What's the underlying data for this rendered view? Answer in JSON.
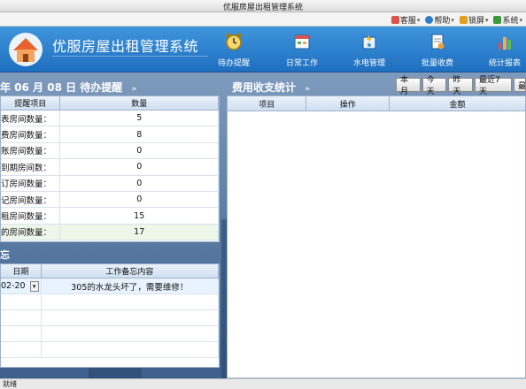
{
  "window": {
    "title": "优服房屋出租管理系统"
  },
  "top_menu": {
    "items": [
      {
        "label": "客服",
        "color": "#d9534f"
      },
      {
        "label": "帮助",
        "color": "#2f7cc7"
      },
      {
        "label": "锁屏",
        "color": "#e0a020"
      },
      {
        "label": "系统",
        "color": "#3a9a3a"
      }
    ]
  },
  "header": {
    "app_title": "优服房屋出租管理系统",
    "nav": [
      {
        "label": "待办提醒"
      },
      {
        "label": "日常工作"
      },
      {
        "label": "水电管理"
      },
      {
        "label": "批量收费"
      },
      {
        "label": "统计报表"
      }
    ]
  },
  "reminders": {
    "title": "年 06 月 08 日 待办提醒",
    "columns": [
      "提醒项目",
      "数量"
    ],
    "rows": [
      {
        "label": "表房间数量：",
        "value": "5"
      },
      {
        "label": "费房间数量：",
        "value": "8"
      },
      {
        "label": "账房间数量：",
        "value": "0"
      },
      {
        "label": "到期房间数：",
        "value": "0"
      },
      {
        "label": "订房间数量：",
        "value": "0"
      },
      {
        "label": "记房间数量：",
        "value": "0"
      },
      {
        "label": "租房间数量：",
        "value": "15"
      },
      {
        "label": "的房间数量：",
        "value": "17"
      }
    ]
  },
  "memo": {
    "title": "忘",
    "columns": [
      "日期",
      "工作备忘内容"
    ],
    "rows": [
      {
        "date": "02-20",
        "content": "305的水龙头坏了，需要维修！"
      }
    ]
  },
  "fees": {
    "title": "费用收支统计",
    "range_buttons": [
      "本月",
      "今天",
      "昨天",
      "最近7天",
      "最"
    ],
    "columns": [
      "项目",
      "操作",
      "金额"
    ]
  },
  "statusbar": {
    "text": "就绪"
  },
  "colors": {
    "header": "#2a7fd0",
    "grid_border": "#9fb3c8"
  }
}
